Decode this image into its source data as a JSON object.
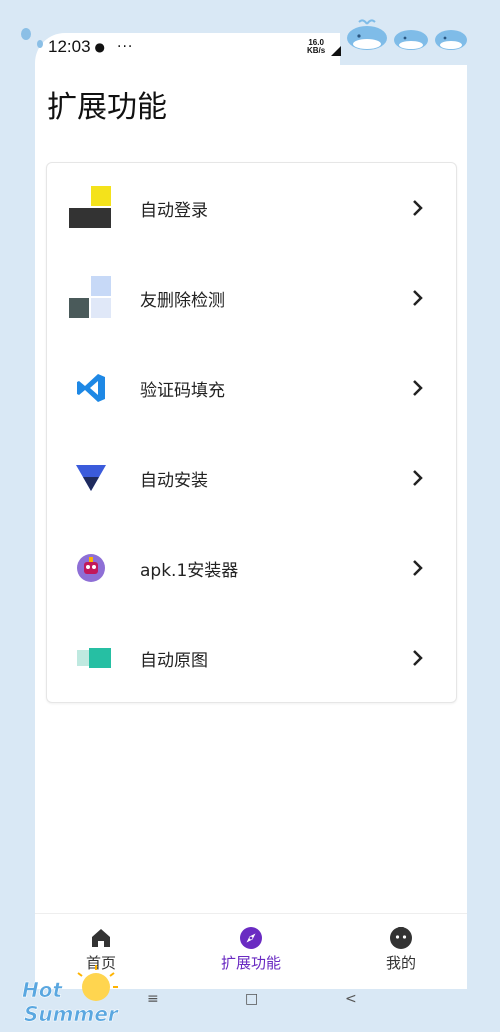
{
  "status": {
    "time": "12:03",
    "dots": "···",
    "speed_value": "16.0",
    "speed_unit": "KB/s"
  },
  "page": {
    "title": "扩展功能"
  },
  "features": [
    {
      "label": "自动登录",
      "icon": "blurred-app-icon-yellow"
    },
    {
      "label": "友删除检测",
      "icon": "blurred-app-icon-blue"
    },
    {
      "label": "验证码填充",
      "icon": "vscode-icon"
    },
    {
      "label": "自动安装",
      "icon": "triangle-install-icon"
    },
    {
      "label": "apk.1安装器",
      "icon": "robot-avatar-icon"
    },
    {
      "label": "自动原图",
      "icon": "blurred-app-icon-teal"
    }
  ],
  "tabs": [
    {
      "label": "首页",
      "icon": "home-icon",
      "active": false
    },
    {
      "label": "扩展功能",
      "icon": "compass-icon",
      "active": true
    },
    {
      "label": "我的",
      "icon": "face-icon",
      "active": false
    }
  ],
  "nav": {
    "menu": "≡",
    "home": "□",
    "back": "<"
  },
  "theme": {
    "accent": "#6a2bc2",
    "background": "#d9e8f5",
    "decoration_text": "Hot Summer"
  }
}
